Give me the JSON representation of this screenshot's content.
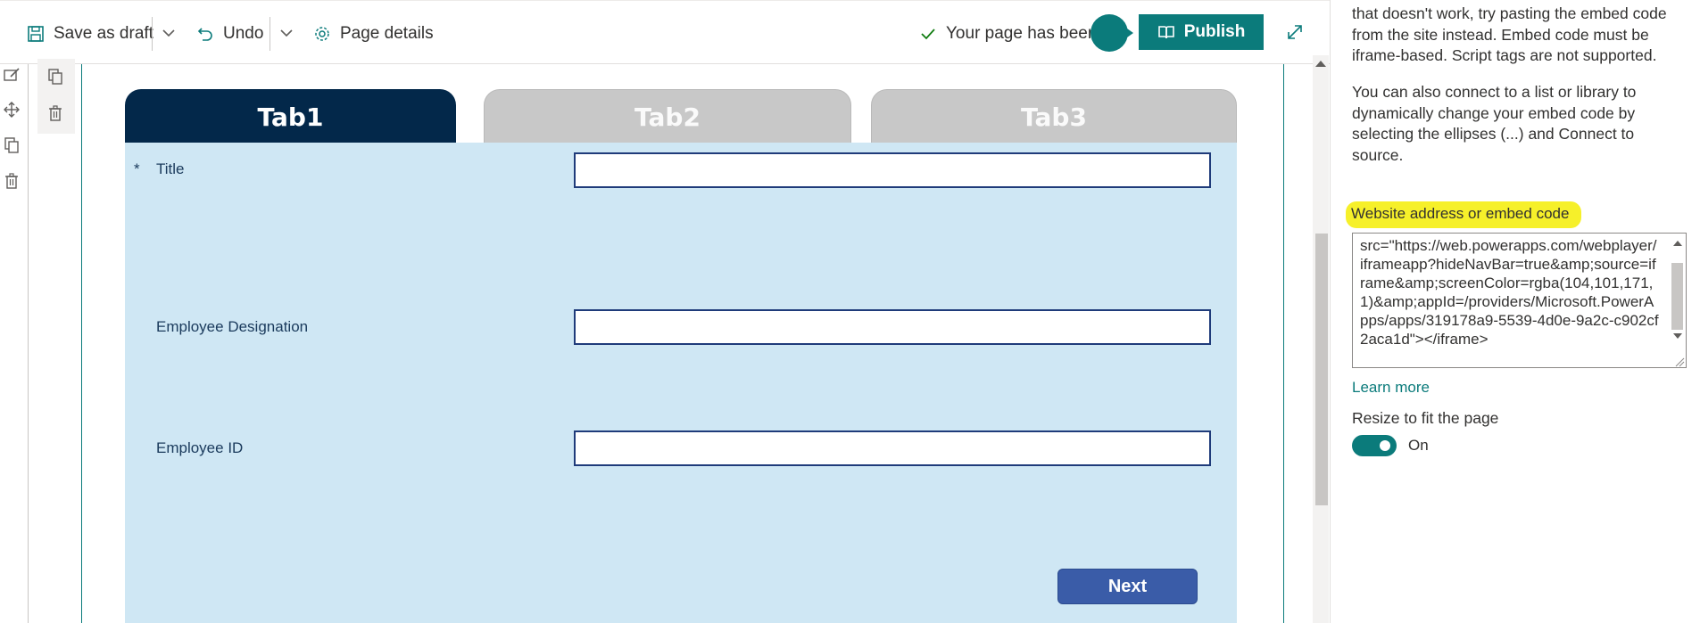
{
  "toolbar": {
    "save_draft_label": "Save as draft",
    "undo_label": "Undo",
    "page_details_label": "Page details",
    "status_text": "Your page has been s",
    "publish_label": "Publish"
  },
  "app": {
    "tabs": [
      {
        "label": "Tab1"
      },
      {
        "label": "Tab2"
      },
      {
        "label": "Tab3"
      }
    ],
    "required_marker": "*",
    "fields": [
      {
        "label": "Title",
        "value": ""
      },
      {
        "label": "Employee Designation",
        "value": ""
      },
      {
        "label": "Employee ID",
        "value": ""
      }
    ],
    "next_label": "Next"
  },
  "pane": {
    "intro_text": "that doesn't work, try pasting the embed code from the site instead. Embed code must be iframe-based. Script tags are not supported.",
    "connect_text": "You can also connect to a list or library to dynamically change your embed code by selecting the ellipses (...) and Connect to source.",
    "embed_label": "Website address or embed code",
    "embed_value": "src=\"https://web.powerapps.com/webplayer/iframeapp?hideNavBar=true&amp;source=iframe&amp;screenColor=rgba(104,101,171,1)&amp;appId=/providers/Microsoft.PowerApps/apps/319178a9-5539-4d0e-9a2c-c902cf2aca1d\"></iframe>",
    "learn_more": "Learn more",
    "resize_label": "Resize to fit the page",
    "toggle_state": "On"
  },
  "colors": {
    "accent": "#0b7b7b",
    "tab_active": "#03284a",
    "tab_inactive": "#c8c8c8",
    "form_background": "#cfe7f4",
    "next_button": "#3a5ca8",
    "highlight": "#f6f02a"
  }
}
